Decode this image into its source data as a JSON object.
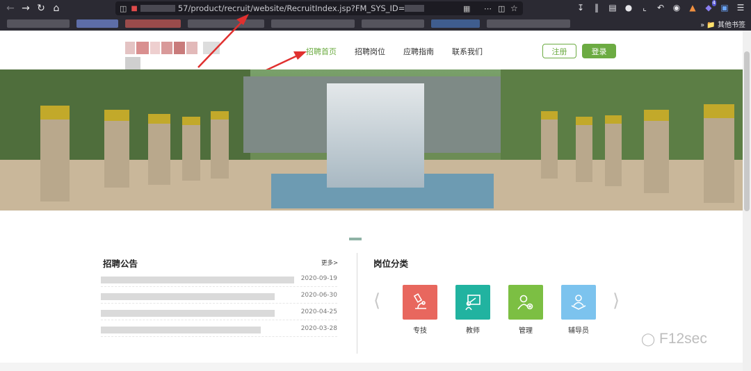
{
  "browser": {
    "url_path": "57/product/recruit/website/RecruitIndex.jsp?FM_SYS_ID=",
    "other_bookmarks": "其他书签",
    "notification_count": "4"
  },
  "header": {
    "nav": [
      "招聘首页",
      "招聘岗位",
      "应聘指南",
      "联系我们"
    ],
    "register_label": "注册",
    "login_label": "登录",
    "accent_color": "#6cab42"
  },
  "notice": {
    "title": "招聘公告",
    "more": "更多>",
    "items": [
      {
        "date": "2020-09-19"
      },
      {
        "date": "2020-06-30"
      },
      {
        "date": "2020-04-25"
      },
      {
        "date": "2020-03-28"
      }
    ]
  },
  "categories": {
    "title": "岗位分类",
    "items": [
      {
        "label": "专技",
        "icon": "microscope-icon",
        "color": "#e8675e"
      },
      {
        "label": "教师",
        "icon": "teacher-board-icon",
        "color": "#21b3a0"
      },
      {
        "label": "管理",
        "icon": "user-gear-icon",
        "color": "#7cbf43"
      },
      {
        "label": "辅导员",
        "icon": "reader-book-icon",
        "color": "#7cc3ee"
      }
    ]
  },
  "watermark": "F12sec"
}
